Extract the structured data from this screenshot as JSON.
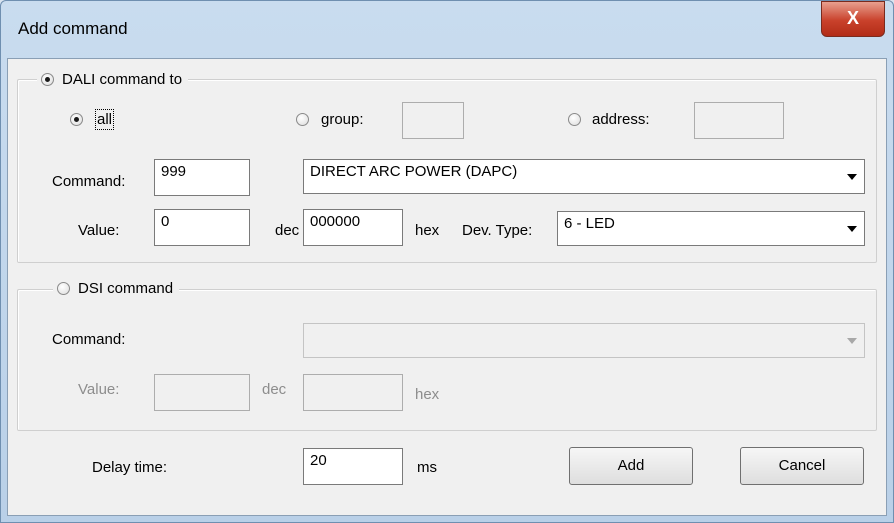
{
  "window": {
    "title": "Add command",
    "close_label": "X"
  },
  "dali": {
    "legend": "DALI command to",
    "selected": true,
    "all_label": "all",
    "group_label": "group:",
    "group_value": "",
    "address_label": "address:",
    "address_value": "",
    "command_label": "Command:",
    "command_code": "999",
    "command_selected": "DIRECT ARC POWER (DAPC)",
    "value_label": "Value:",
    "value_dec": "0",
    "dec_label": "dec",
    "value_hex": "000000",
    "hex_label": "hex",
    "devtype_label": "Dev. Type:",
    "devtype_selected": "6 - LED"
  },
  "dsi": {
    "legend": "DSI command",
    "selected": false,
    "command_label": "Command:",
    "command_selected": "",
    "value_label": "Value:",
    "value_dec": "",
    "dec_label": "dec",
    "value_hex": "",
    "hex_label": "hex"
  },
  "footer": {
    "delay_label": "Delay time:",
    "delay_value": "20",
    "ms_label": "ms",
    "add_label": "Add",
    "cancel_label": "Cancel"
  },
  "icons": [
    "close-icon",
    "radio-icon",
    "dropdown-arrow-icon"
  ]
}
